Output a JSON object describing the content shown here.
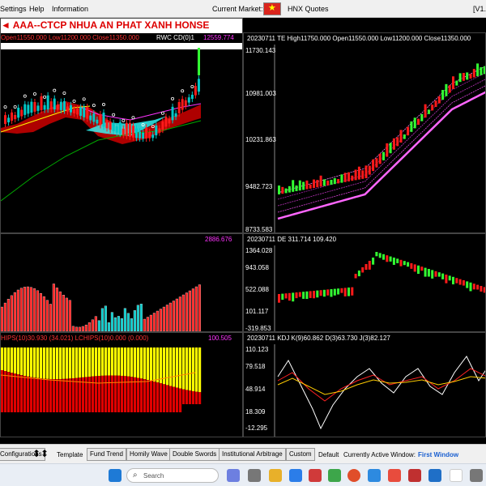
{
  "menu": {
    "settings": "Settings",
    "help": "Help",
    "information": "Information",
    "market_label": "Current Market:",
    "market_value": "HNX Quotes",
    "version": "[V1."
  },
  "main_chart": {
    "title": "AAA--CTCP NHUA AN PHAT XANH  HONSE",
    "ohlc": "Open11550.000 Low11200.000 Close11350.000",
    "indicator": "RWC CD(0)1",
    "value": "12559.774"
  },
  "te_chart": {
    "header": "20230711 TE High11750.000 Open11550.000 Low11200.000 Close11350.000",
    "ticks": [
      "11730.143",
      "10981.003",
      "10231.863",
      "9482.723",
      "8733.583"
    ]
  },
  "mid_left": {
    "value": "2886.676"
  },
  "de_chart": {
    "header": "20230711 DE 311.714 109.420",
    "ticks": [
      "1364.028",
      "943.058",
      "522.088",
      "101.117",
      "-319.853"
    ]
  },
  "bot_left": {
    "header": "HIPS(10)30.930 (34.021) LCHIPS(10)0.000 (0.000)",
    "value": "100.505"
  },
  "kdj_chart": {
    "header": "20230711 KDJ K(9)60.862 D(3)63.730 J(3)82.127",
    "ticks": [
      "110.123",
      "79.518",
      "48.914",
      "18.309",
      "-12.295"
    ]
  },
  "bottom": {
    "configurations": "Configurations",
    "template_label": "Template",
    "templates": [
      "Fund Trend",
      "Homily Wave",
      "Double Swords",
      "Institutional Arbitrage",
      "Custom"
    ],
    "default": "Default",
    "active_label": "Currently Active Window:",
    "active_value": "First Window"
  },
  "taskbar": {
    "search_placeholder": "Search"
  },
  "colors": {
    "up": "#ff1a1a",
    "down": "#00c8c8",
    "green": "#33ff33",
    "magenta": "#ff33ff",
    "yellow": "#ffff00"
  }
}
